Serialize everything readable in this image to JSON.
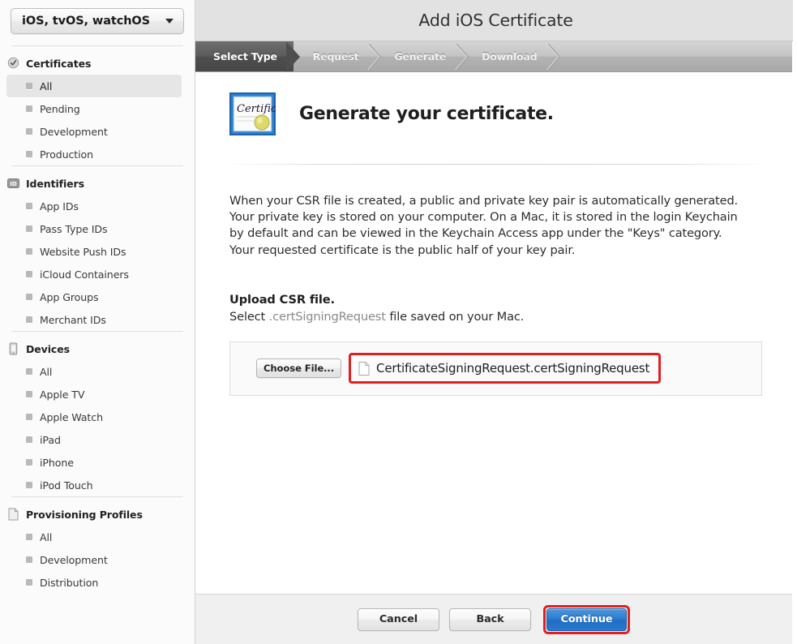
{
  "sidebar": {
    "team_select": {
      "value": "iOS, tvOS, watchOS",
      "caret_icon": "chevron-down-icon"
    },
    "sections": [
      {
        "id": "certificates",
        "label": "Certificates",
        "icon": "certificate-seal-icon",
        "items": [
          {
            "label": "All",
            "selected": true
          },
          {
            "label": "Pending",
            "selected": false
          },
          {
            "label": "Development",
            "selected": false
          },
          {
            "label": "Production",
            "selected": false
          }
        ]
      },
      {
        "id": "identifiers",
        "label": "Identifiers",
        "icon": "id-badge-icon",
        "items": [
          {
            "label": "App IDs",
            "selected": false
          },
          {
            "label": "Pass Type IDs",
            "selected": false
          },
          {
            "label": "Website Push IDs",
            "selected": false
          },
          {
            "label": "iCloud Containers",
            "selected": false
          },
          {
            "label": "App Groups",
            "selected": false
          },
          {
            "label": "Merchant IDs",
            "selected": false
          }
        ]
      },
      {
        "id": "devices",
        "label": "Devices",
        "icon": "device-phone-icon",
        "items": [
          {
            "label": "All",
            "selected": false
          },
          {
            "label": "Apple TV",
            "selected": false
          },
          {
            "label": "Apple Watch",
            "selected": false
          },
          {
            "label": "iPad",
            "selected": false
          },
          {
            "label": "iPhone",
            "selected": false
          },
          {
            "label": "iPod Touch",
            "selected": false
          }
        ]
      },
      {
        "id": "provisioning-profiles",
        "label": "Provisioning Profiles",
        "icon": "document-page-icon",
        "items": [
          {
            "label": "All",
            "selected": false
          },
          {
            "label": "Development",
            "selected": false
          },
          {
            "label": "Distribution",
            "selected": false
          }
        ]
      }
    ]
  },
  "header": {
    "title": "Add iOS Certificate"
  },
  "wizard": {
    "steps": [
      {
        "label": "Select Type",
        "active": true
      },
      {
        "label": "Request",
        "active": false
      },
      {
        "label": "Generate",
        "active": false
      },
      {
        "label": "Download",
        "active": false
      }
    ]
  },
  "main": {
    "hero": {
      "icon": "certificate-icon",
      "title": "Generate your certificate."
    },
    "paragraph": "When your CSR file is created, a public and private key pair is automatically generated. Your private key is stored on your computer. On a Mac, it is stored in the login Keychain by default and can be viewed in the Keychain Access app under the \"Keys\" category. Your requested certificate is the public half of your key pair.",
    "upload": {
      "heading": "Upload CSR file.",
      "sub_prefix": "Select ",
      "sub_extension": ".certSigningRequest",
      "sub_suffix": " file saved on your Mac.",
      "choose_button": "Choose File...",
      "file_icon": "document-file-icon",
      "file_name": "CertificateSigningRequest.certSigningRequest",
      "highlight_color": "#e02020"
    }
  },
  "footer": {
    "cancel_label": "Cancel",
    "back_label": "Back",
    "continue_label": "Continue",
    "continue_color": "#2b7bcd",
    "highlight_color": "#e02020"
  }
}
